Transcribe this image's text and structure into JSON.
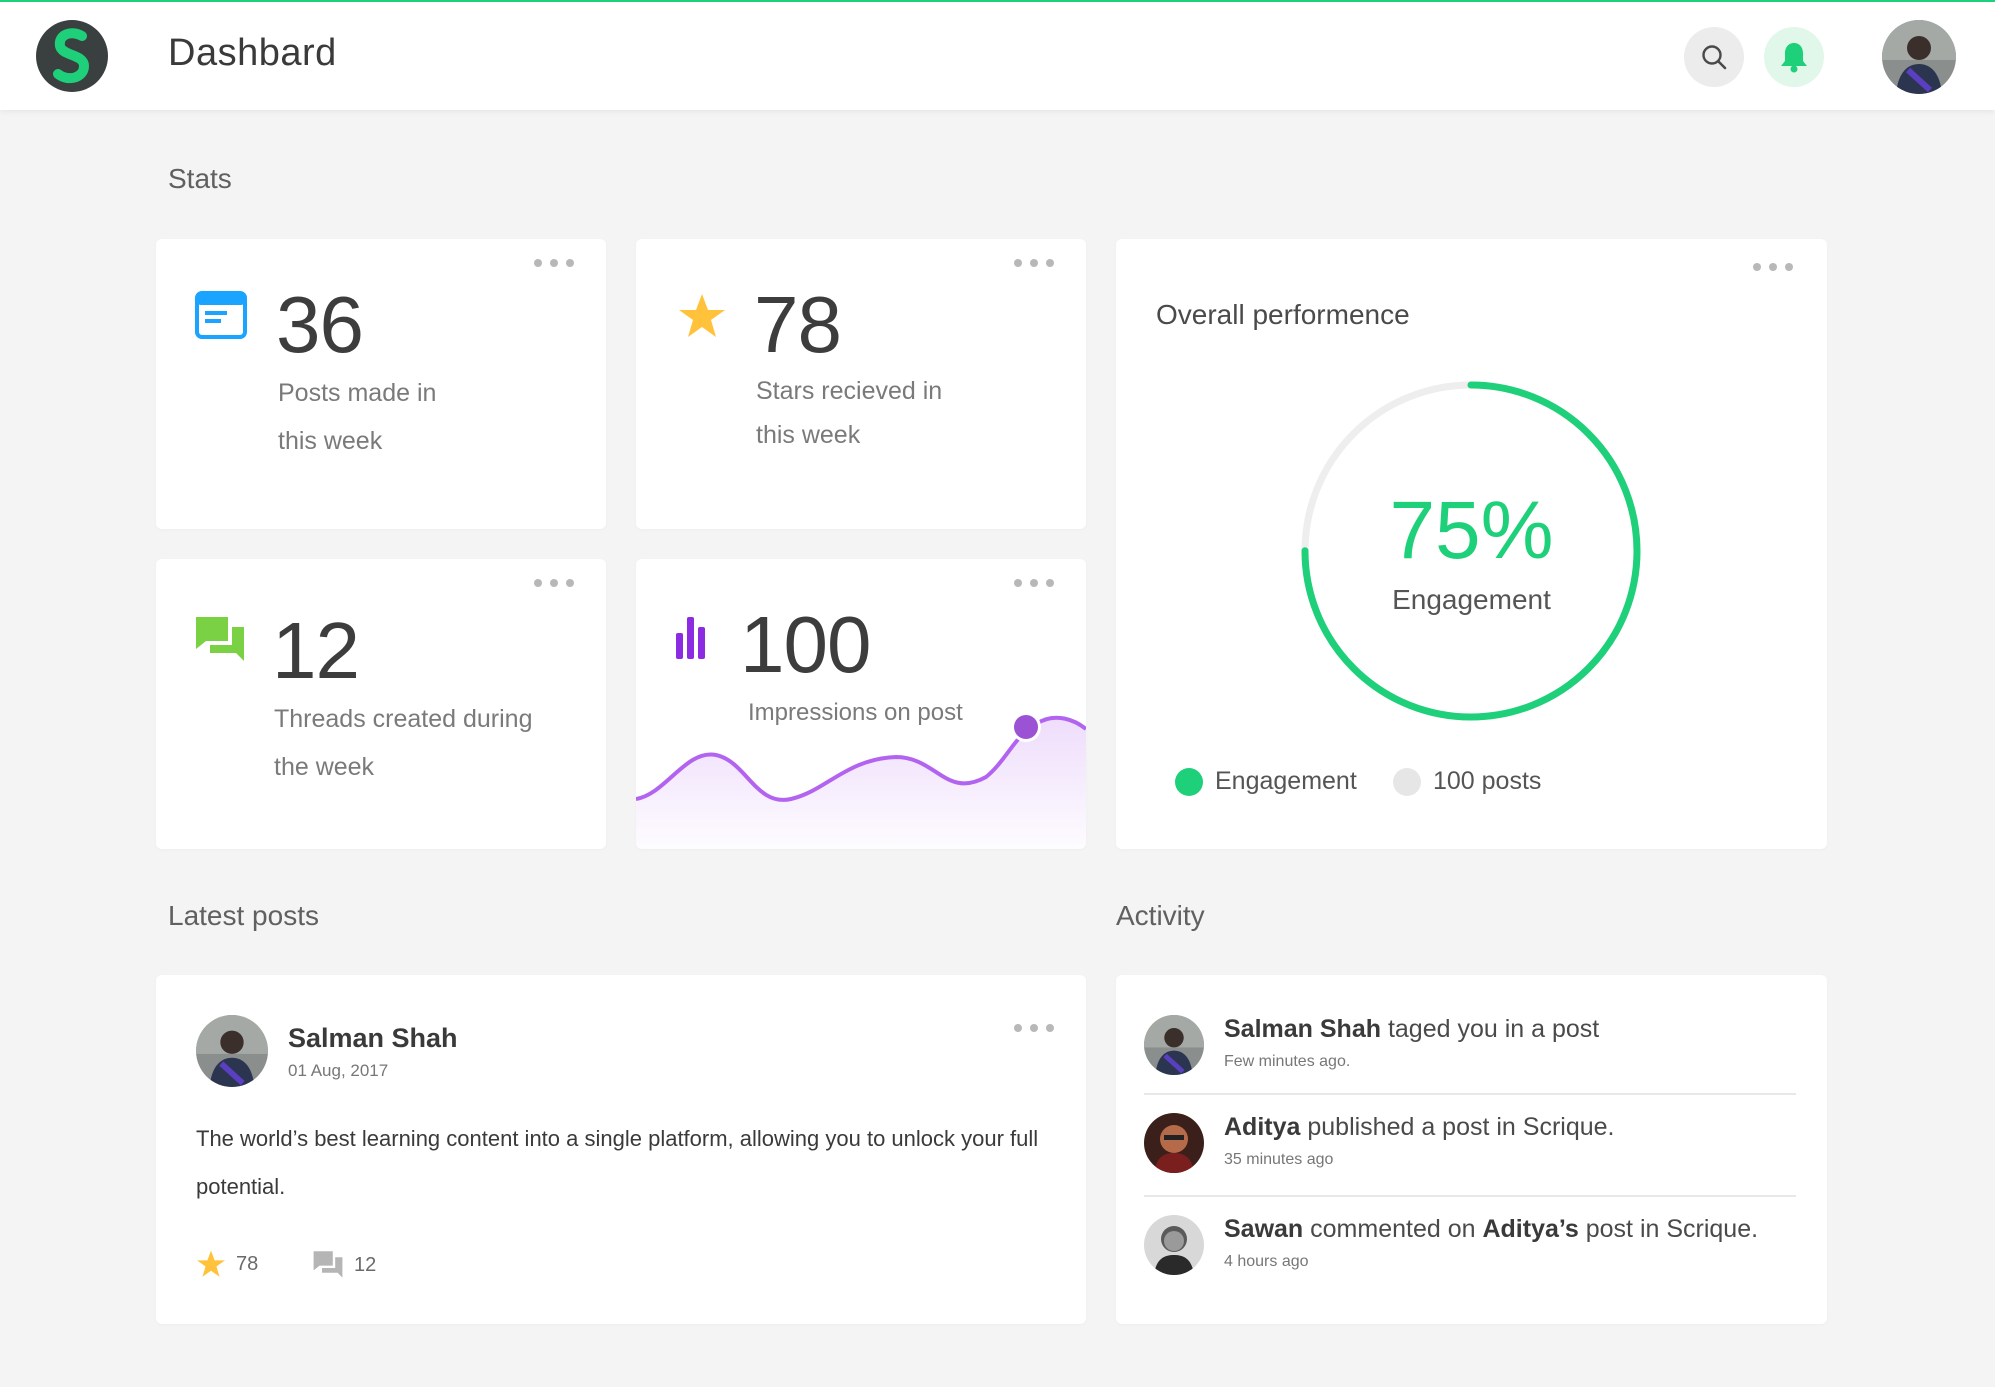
{
  "header": {
    "title": "Dashbard",
    "logo_letter": "S",
    "search_icon": "search-icon",
    "bell_icon": "bell-icon"
  },
  "sections": {
    "stats": "Stats",
    "latest_posts": "Latest posts",
    "activity": "Activity"
  },
  "colors": {
    "accent_green": "#1fd07a",
    "blue": "#1aa3ff",
    "star": "#ffc23a",
    "chat_green": "#7ad143",
    "purple": "#8b2be2",
    "wave": "#b264f0"
  },
  "stats": {
    "posts": {
      "value": "36",
      "label_line1": "Posts made in",
      "label_line2": "this week",
      "icon": "window-icon"
    },
    "stars": {
      "value": "78",
      "label_line1": "Stars recieved in",
      "label_line2": "this week",
      "icon": "star-icon"
    },
    "threads": {
      "value": "12",
      "label_line1": "Threads created during",
      "label_line2": "the week",
      "icon": "chat-icon"
    },
    "impressions": {
      "value": "100",
      "label": "Impressions on post",
      "icon": "bar-chart-icon"
    }
  },
  "performance": {
    "title": "Overall performence",
    "value_label": "75%",
    "percent": 75,
    "sublabel": "Engagement",
    "legend": [
      {
        "label": "Engagement",
        "color": "#1fd07a"
      },
      {
        "label": "100 posts",
        "color": "#e6e6e6"
      }
    ]
  },
  "latest_post": {
    "author": "Salman Shah",
    "date": "01 Aug, 2017",
    "body": "The world’s best learning content into a single platform, allowing you to unlock your full potential.",
    "stars": "78",
    "comments": "12"
  },
  "activity": [
    {
      "name": "Salman Shah",
      "text": " taged you in a post",
      "extra_name": "",
      "extra_text": "",
      "time": "Few minutes ago."
    },
    {
      "name": "Aditya",
      "text": " published a post in Scrique.",
      "extra_name": "",
      "extra_text": "",
      "time": "35 minutes ago"
    },
    {
      "name": "Sawan",
      "text": " commented on ",
      "extra_name": "Aditya’s",
      "extra_text": " post in Scrique.",
      "time": "4 hours ago"
    }
  ]
}
